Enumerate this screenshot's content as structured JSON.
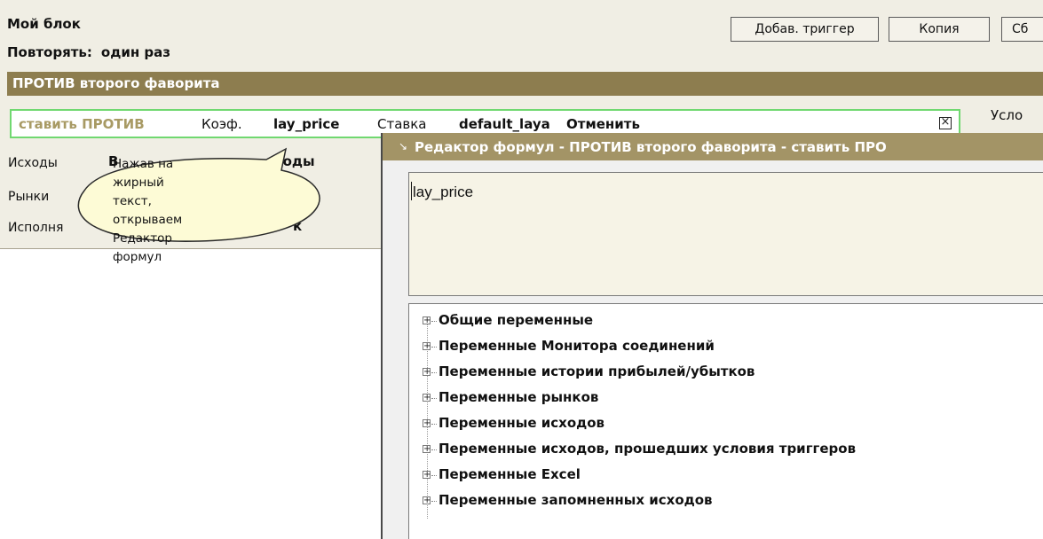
{
  "rule": {
    "block_title": "Мой блок",
    "repeat_label": "Повторять:",
    "repeat_value": "один раз",
    "buttons": {
      "add_trigger": "Добав. триггер",
      "copy": "Копия",
      "reset": "Сб"
    },
    "action_title": "ПРОТИВ второго фаворита",
    "bet": {
      "type": "ставить ПРОТИВ",
      "coef_label": "Коэф.",
      "coef_value": "lay_price",
      "stake_label": "Ставка",
      "stake_value": "default_laya",
      "cancel": "Отменить",
      "close_icon": "☒"
    },
    "conditions_label": "Усло",
    "rows": {
      "outcomes_label": "Исходы",
      "outcomes_frag_a": "В",
      "outcomes_frag_b": "сходы",
      "markets_label": "Рынки",
      "exec_label": "Исполня",
      "exec_frag": "к"
    }
  },
  "callout": {
    "lines": [
      "Нажав на жирный",
      "текст, открываем",
      "Редактор формул"
    ]
  },
  "editor": {
    "title": "Редактор формул - ПРОТИВ второго фаворита - ставить ПРО",
    "formula": "lay_price",
    "tree_items": [
      "Общие переменные",
      "Переменные Монитора соединений",
      "Переменные истории прибылей/убытков",
      "Переменные рынков",
      "Переменные исходов",
      "Переменные исходов, прошедших условия триггеров",
      "Переменные Excel",
      "Переменные запомненных исходов"
    ]
  },
  "colors": {
    "panel_bg": "#f0eee4",
    "title_bar": "#8d7d4f",
    "editor_title": "#a39466",
    "bet_border": "#70d870",
    "callout_fill": "#fdfbd6"
  }
}
